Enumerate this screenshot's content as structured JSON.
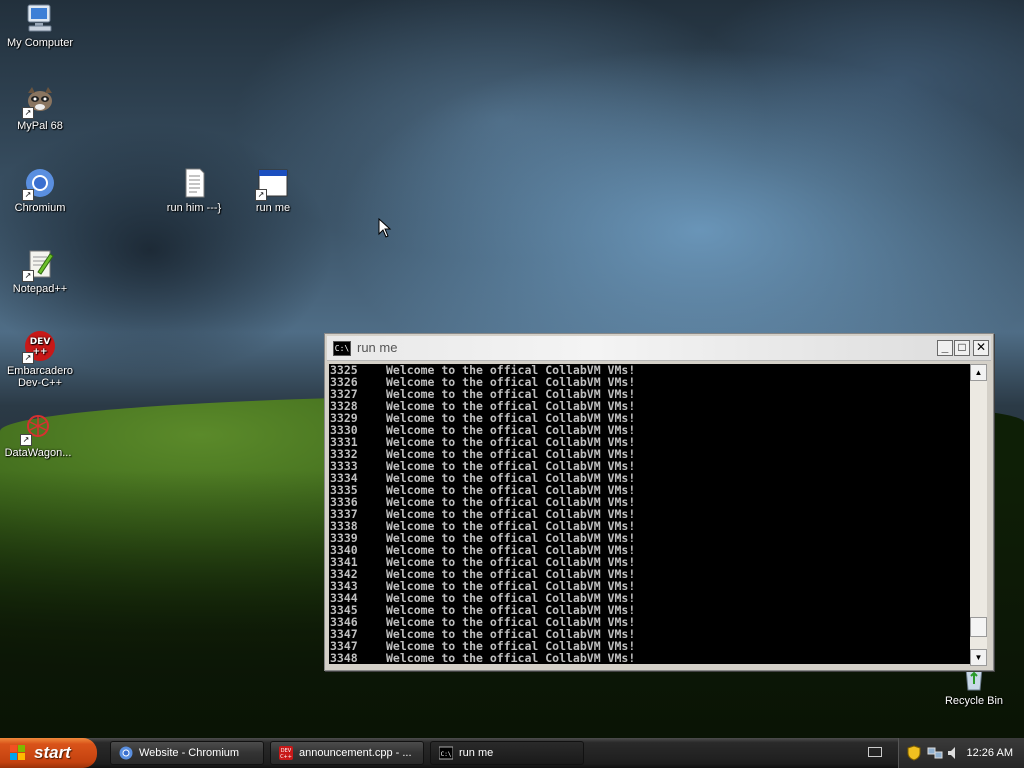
{
  "desktop": {
    "icons": [
      {
        "label": "My Computer"
      },
      {
        "label": "MyPal 68"
      },
      {
        "label": "Chromium"
      },
      {
        "label": "Notepad++"
      },
      {
        "label": "Embarcadero Dev-C++"
      },
      {
        "label": "DataWagon..."
      },
      {
        "label": "run him ---}"
      },
      {
        "label": "run me"
      },
      {
        "label": "Recycle Bin"
      }
    ]
  },
  "console_window": {
    "title": "run me",
    "icon_text": "C:\\",
    "lines": [
      {
        "n": "3325",
        "text": "Welcome to the offical CollabVM VMs!"
      },
      {
        "n": "3326",
        "text": "Welcome to the offical CollabVM VMs!"
      },
      {
        "n": "3327",
        "text": "Welcome to the offical CollabVM VMs!"
      },
      {
        "n": "3328",
        "text": "Welcome to the offical CollabVM VMs!"
      },
      {
        "n": "3329",
        "text": "Welcome to the offical CollabVM VMs!"
      },
      {
        "n": "3330",
        "text": "Welcome to the offical CollabVM VMs!"
      },
      {
        "n": "3331",
        "text": "Welcome to the offical CollabVM VMs!"
      },
      {
        "n": "3332",
        "text": "Welcome to the offical CollabVM VMs!"
      },
      {
        "n": "3333",
        "text": "Welcome to the offical CollabVM VMs!"
      },
      {
        "n": "3334",
        "text": "Welcome to the offical CollabVM VMs!"
      },
      {
        "n": "3335",
        "text": "Welcome to the offical CollabVM VMs!"
      },
      {
        "n": "3336",
        "text": "Welcome to the offical CollabVM VMs!"
      },
      {
        "n": "3337",
        "text": "Welcome to the offical CollabVM VMs!"
      },
      {
        "n": "3338",
        "text": "Welcome to the offical CollabVM VMs!"
      },
      {
        "n": "3339",
        "text": "Welcome to the offical CollabVM VMs!"
      },
      {
        "n": "3340",
        "text": "Welcome to the offical CollabVM VMs!"
      },
      {
        "n": "3341",
        "text": "Welcome to the offical CollabVM VMs!"
      },
      {
        "n": "3342",
        "text": "Welcome to the offical CollabVM VMs!"
      },
      {
        "n": "3343",
        "text": "Welcome to the offical CollabVM VMs!"
      },
      {
        "n": "3344",
        "text": "Welcome to the offical CollabVM VMs!"
      },
      {
        "n": "3345",
        "text": "Welcome to the offical CollabVM VMs!"
      },
      {
        "n": "3346",
        "text": "Welcome to the offical CollabVM VMs!"
      },
      {
        "n": "3347",
        "text": "Welcome to the offical CollabVM VMs!"
      },
      {
        "n": "3347",
        "text": "Welcome to the offical CollabVM VMs!"
      },
      {
        "n": "3348",
        "text": "Welcome to the offical CollabVM VMs!"
      }
    ],
    "scroll_position": 0.95
  },
  "taskbar": {
    "start_label": "start",
    "tasks": [
      {
        "label": "Website - Chromium"
      },
      {
        "label": "announcement.cpp - ..."
      },
      {
        "label": "run me"
      }
    ],
    "clock": "12:26 AM"
  }
}
